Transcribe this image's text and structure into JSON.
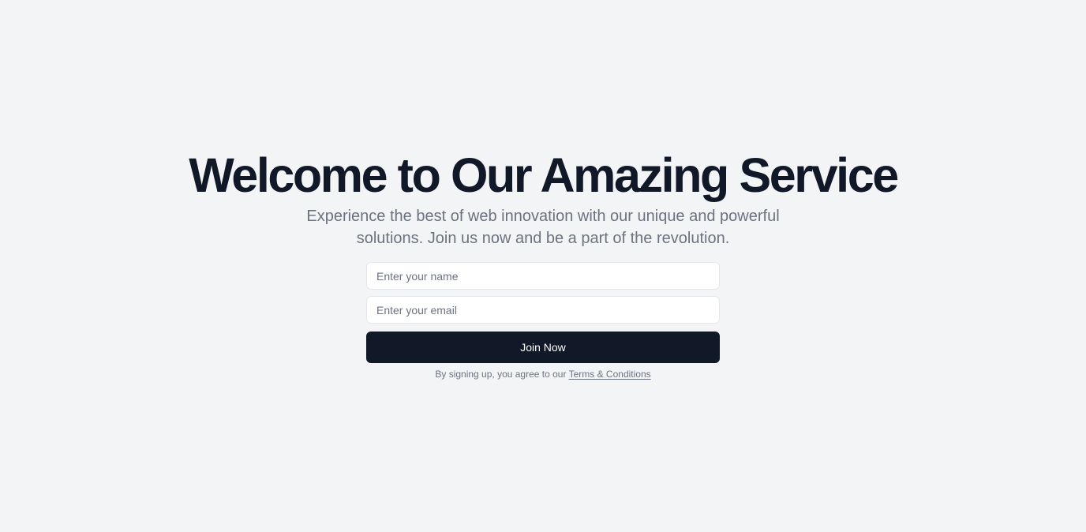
{
  "hero": {
    "title": "Welcome to Our Amazing Service",
    "subtitle": "Experience the best of web innovation with our unique and powerful solutions. Join us now and be a part of the revolution."
  },
  "form": {
    "name_placeholder": "Enter your name",
    "email_placeholder": "Enter your email",
    "submit_label": "Join Now"
  },
  "legal": {
    "prefix": "By signing up, you agree to our ",
    "link_label": "Terms & Conditions"
  },
  "colors": {
    "background": "#f3f4f6",
    "heading": "#111827",
    "muted_text": "#6b7280",
    "button_bg": "#111827",
    "button_text": "#ffffff"
  }
}
